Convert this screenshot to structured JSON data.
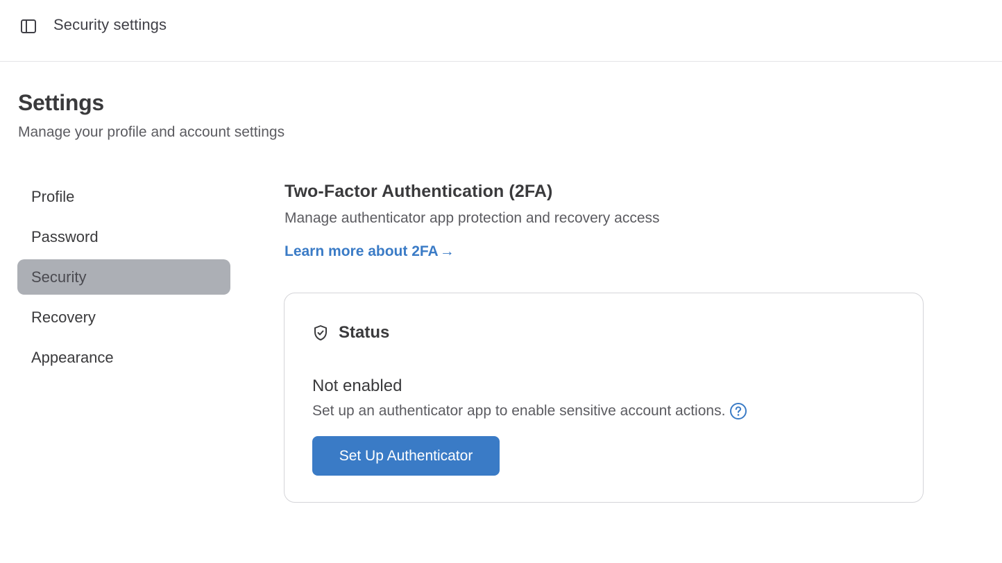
{
  "header": {
    "title": "Security settings",
    "toggle_icon": "sidebar-panel-icon"
  },
  "page": {
    "title": "Settings",
    "subtitle": "Manage your profile and account settings"
  },
  "sidebar": {
    "items": [
      {
        "label": "Profile",
        "active": false
      },
      {
        "label": "Password",
        "active": false
      },
      {
        "label": "Security",
        "active": true
      },
      {
        "label": "Recovery",
        "active": false
      },
      {
        "label": "Appearance",
        "active": false
      }
    ]
  },
  "section": {
    "title": "Two-Factor Authentication (2FA)",
    "description": "Manage authenticator app protection and recovery access",
    "learn_more": "Learn more about 2FA",
    "learn_more_arrow": "→"
  },
  "status_card": {
    "heading": "Status",
    "heading_icon": "shield-check-icon",
    "value": "Not enabled",
    "description": "Set up an authenticator app to enable sensitive account actions.",
    "help_icon": "question-circle-icon",
    "button_label": "Set Up Authenticator"
  },
  "colors": {
    "accent": "#3a7bc6",
    "active_nav_bg": "#acafb5",
    "border": "#d4d4d8"
  }
}
